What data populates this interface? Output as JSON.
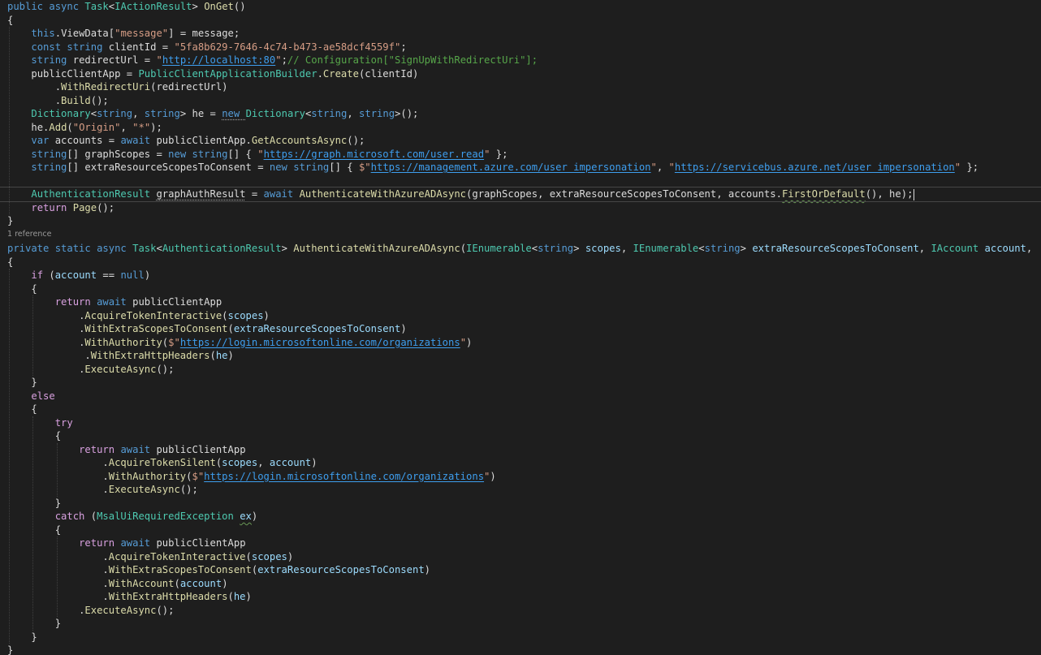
{
  "editor": {
    "colors": {
      "background": "#1e1e1e",
      "keyword": "#569cd6",
      "control": "#d8a0df",
      "type": "#4ec9b0",
      "method": "#dcdcaa",
      "string": "#d69d85",
      "comment": "#57a64a",
      "variable": "#9cdcfe",
      "plain": "#dcdcdc",
      "url": "#3e9eee"
    },
    "code_lens": "1 reference",
    "lines": [
      [
        [
          "public ",
          "keyword"
        ],
        [
          "async ",
          "keyword"
        ],
        [
          "Task",
          "type"
        ],
        [
          "<",
          "plain"
        ],
        [
          "IActionResult",
          "type"
        ],
        [
          "> ",
          "plain"
        ],
        [
          "OnGet",
          "method"
        ],
        [
          "()",
          "plain"
        ]
      ],
      [
        [
          "{",
          "plain"
        ]
      ],
      [
        [
          "    ",
          "plain"
        ],
        [
          "this",
          "keyword"
        ],
        [
          ".",
          "plain"
        ],
        [
          "ViewData",
          "plain"
        ],
        [
          "[",
          "plain"
        ],
        [
          "\"message\"",
          "string"
        ],
        [
          "] = ",
          "plain"
        ],
        [
          "message",
          "plain"
        ],
        [
          ";",
          "plain"
        ]
      ],
      [
        [
          "    ",
          "plain"
        ],
        [
          "const ",
          "keyword"
        ],
        [
          "string ",
          "keyword"
        ],
        [
          "clientId",
          "plain"
        ],
        [
          " = ",
          "plain"
        ],
        [
          "\"5fa8b629-7646-4c74-b473-ae58dcf4559f\"",
          "string"
        ],
        [
          ";",
          "plain"
        ]
      ],
      [
        [
          "    ",
          "plain"
        ],
        [
          "string ",
          "keyword"
        ],
        [
          "redirectUrl",
          "plain"
        ],
        [
          " = ",
          "plain"
        ],
        [
          "\"",
          "string"
        ],
        [
          "http://localhost:80",
          "url"
        ],
        [
          "\"",
          "string"
        ],
        [
          ";",
          "plain"
        ],
        [
          "// Configuration[\"SignUpWithRedirectUri\"];",
          "comment"
        ]
      ],
      [
        [
          "    ",
          "plain"
        ],
        [
          "publicClientApp",
          "plain"
        ],
        [
          " = ",
          "plain"
        ],
        [
          "PublicClientApplicationBuilder",
          "type"
        ],
        [
          ".",
          "plain"
        ],
        [
          "Create",
          "method"
        ],
        [
          "(",
          "plain"
        ],
        [
          "clientId",
          "plain"
        ],
        [
          ")",
          "plain"
        ]
      ],
      [
        [
          "        ",
          "plain"
        ],
        [
          ".",
          "plain"
        ],
        [
          "WithRedirectUri",
          "method"
        ],
        [
          "(",
          "plain"
        ],
        [
          "redirectUrl",
          "plain"
        ],
        [
          ")",
          "plain"
        ]
      ],
      [
        [
          "        ",
          "plain"
        ],
        [
          ".",
          "plain"
        ],
        [
          "Build",
          "method"
        ],
        [
          "();",
          "plain"
        ]
      ],
      [
        [
          "    ",
          "plain"
        ],
        [
          "Dictionary",
          "type"
        ],
        [
          "<",
          "plain"
        ],
        [
          "string",
          "keyword"
        ],
        [
          ", ",
          "plain"
        ],
        [
          "string",
          "keyword"
        ],
        [
          "> ",
          "plain"
        ],
        [
          "he",
          "plain"
        ],
        [
          " = ",
          "plain"
        ],
        [
          "new ",
          "keyword"
        ],
        [
          "Dictionary",
          "type"
        ],
        [
          "<",
          "plain"
        ],
        [
          "string",
          "keyword"
        ],
        [
          ", ",
          "plain"
        ],
        [
          "string",
          "keyword"
        ],
        [
          ">();",
          "plain"
        ]
      ],
      [
        [
          "    ",
          "plain"
        ],
        [
          "he",
          "plain"
        ],
        [
          ".",
          "plain"
        ],
        [
          "Add",
          "method"
        ],
        [
          "(",
          "plain"
        ],
        [
          "\"Origin\"",
          "string"
        ],
        [
          ", ",
          "plain"
        ],
        [
          "\"*\"",
          "string"
        ],
        [
          ");",
          "plain"
        ]
      ],
      [
        [
          "    ",
          "plain"
        ],
        [
          "var ",
          "keyword"
        ],
        [
          "accounts",
          "plain"
        ],
        [
          " = ",
          "plain"
        ],
        [
          "await ",
          "keyword"
        ],
        [
          "publicClientApp",
          "plain"
        ],
        [
          ".",
          "plain"
        ],
        [
          "GetAccountsAsync",
          "method"
        ],
        [
          "();",
          "plain"
        ]
      ],
      [
        [
          "    ",
          "plain"
        ],
        [
          "string",
          "keyword"
        ],
        [
          "[] ",
          "plain"
        ],
        [
          "graphScopes",
          "plain"
        ],
        [
          " = ",
          "plain"
        ],
        [
          "new ",
          "keyword"
        ],
        [
          "string",
          "keyword"
        ],
        [
          "[] { ",
          "plain"
        ],
        [
          "\"",
          "string"
        ],
        [
          "https://graph.microsoft.com/user.read",
          "url"
        ],
        [
          "\"",
          "string"
        ],
        [
          " };",
          "plain"
        ]
      ],
      [
        [
          "    ",
          "plain"
        ],
        [
          "string",
          "keyword"
        ],
        [
          "[] ",
          "plain"
        ],
        [
          "extraResourceScopesToConsent",
          "plain"
        ],
        [
          " = ",
          "plain"
        ],
        [
          "new ",
          "keyword"
        ],
        [
          "string",
          "keyword"
        ],
        [
          "[] { ",
          "plain"
        ],
        [
          "$\"",
          "string"
        ],
        [
          "https://management.azure.com/user_impersonation",
          "url"
        ],
        [
          "\"",
          "string"
        ],
        [
          ", ",
          "plain"
        ],
        [
          "\"",
          "string"
        ],
        [
          "https://servicebus.azure.net/user_impersonation",
          "url"
        ],
        [
          "\"",
          "string"
        ],
        [
          " };",
          "plain"
        ]
      ],
      [],
      [
        [
          "    ",
          "plain"
        ],
        [
          "AuthenticationResult ",
          "type"
        ],
        [
          "graphAuthResult",
          "plain"
        ],
        [
          " = ",
          "plain"
        ],
        [
          "await ",
          "keyword"
        ],
        [
          "AuthenticateWithAzureADAsync",
          "method"
        ],
        [
          "(",
          "plain"
        ],
        [
          "graphScopes",
          "plain"
        ],
        [
          ", ",
          "plain"
        ],
        [
          "extraResourceScopesToConsent",
          "plain"
        ],
        [
          ", ",
          "plain"
        ],
        [
          "accounts",
          "plain"
        ],
        [
          ".",
          "plain"
        ],
        [
          "FirstOrDefault",
          "method"
        ],
        [
          "(), ",
          "plain"
        ],
        [
          "he",
          "plain"
        ],
        [
          ");",
          "plain"
        ]
      ],
      [
        [
          "    ",
          "plain"
        ],
        [
          "return ",
          "control"
        ],
        [
          "Page",
          "method"
        ],
        [
          "();",
          "plain"
        ]
      ],
      [
        [
          "}",
          "plain"
        ]
      ],
      [
        [
          "private ",
          "keyword"
        ],
        [
          "static ",
          "keyword"
        ],
        [
          "async ",
          "keyword"
        ],
        [
          "Task",
          "type"
        ],
        [
          "<",
          "plain"
        ],
        [
          "AuthenticationResult",
          "type"
        ],
        [
          "> ",
          "plain"
        ],
        [
          "AuthenticateWithAzureADAsync",
          "method"
        ],
        [
          "(",
          "plain"
        ],
        [
          "IEnumerable",
          "type"
        ],
        [
          "<",
          "plain"
        ],
        [
          "string",
          "keyword"
        ],
        [
          "> ",
          "plain"
        ],
        [
          "scopes",
          "variable"
        ],
        [
          ", ",
          "plain"
        ],
        [
          "IEnumerable",
          "type"
        ],
        [
          "<",
          "plain"
        ],
        [
          "string",
          "keyword"
        ],
        [
          "> ",
          "plain"
        ],
        [
          "extraResourceScopesToConsent",
          "variable"
        ],
        [
          ", ",
          "plain"
        ],
        [
          "IAccount ",
          "type"
        ],
        [
          "account",
          "variable"
        ],
        [
          ",",
          "plain"
        ]
      ],
      [
        [
          "{",
          "plain"
        ]
      ],
      [
        [
          "    ",
          "plain"
        ],
        [
          "if ",
          "control"
        ],
        [
          "(",
          "plain"
        ],
        [
          "account",
          "variable"
        ],
        [
          " == ",
          "plain"
        ],
        [
          "null",
          "keyword"
        ],
        [
          ")",
          "plain"
        ]
      ],
      [
        [
          "    ",
          "plain"
        ],
        [
          "{",
          "plain"
        ]
      ],
      [
        [
          "        ",
          "plain"
        ],
        [
          "return ",
          "control"
        ],
        [
          "await ",
          "keyword"
        ],
        [
          "publicClientApp",
          "plain"
        ]
      ],
      [
        [
          "            ",
          "plain"
        ],
        [
          ".",
          "plain"
        ],
        [
          "AcquireTokenInteractive",
          "method"
        ],
        [
          "(",
          "plain"
        ],
        [
          "scopes",
          "variable"
        ],
        [
          ")",
          "plain"
        ]
      ],
      [
        [
          "            ",
          "plain"
        ],
        [
          ".",
          "plain"
        ],
        [
          "WithExtraScopesToConsent",
          "method"
        ],
        [
          "(",
          "plain"
        ],
        [
          "extraResourceScopesToConsent",
          "variable"
        ],
        [
          ")",
          "plain"
        ]
      ],
      [
        [
          "            ",
          "plain"
        ],
        [
          ".",
          "plain"
        ],
        [
          "WithAuthority",
          "method"
        ],
        [
          "(",
          "plain"
        ],
        [
          "$\"",
          "string"
        ],
        [
          "https://login.microsoftonline.com/organizations",
          "url"
        ],
        [
          "\"",
          "string"
        ],
        [
          ")",
          "plain"
        ]
      ],
      [
        [
          "             ",
          "plain"
        ],
        [
          ".",
          "plain"
        ],
        [
          "WithExtraHttpHeaders",
          "method"
        ],
        [
          "(",
          "plain"
        ],
        [
          "he",
          "variable"
        ],
        [
          ")",
          "plain"
        ]
      ],
      [
        [
          "            ",
          "plain"
        ],
        [
          ".",
          "plain"
        ],
        [
          "ExecuteAsync",
          "method"
        ],
        [
          "();",
          "plain"
        ]
      ],
      [
        [
          "    ",
          "plain"
        ],
        [
          "}",
          "plain"
        ]
      ],
      [
        [
          "    ",
          "plain"
        ],
        [
          "else",
          "control"
        ]
      ],
      [
        [
          "    ",
          "plain"
        ],
        [
          "{",
          "plain"
        ]
      ],
      [
        [
          "        ",
          "plain"
        ],
        [
          "try",
          "control"
        ]
      ],
      [
        [
          "        ",
          "plain"
        ],
        [
          "{",
          "plain"
        ]
      ],
      [
        [
          "            ",
          "plain"
        ],
        [
          "return ",
          "control"
        ],
        [
          "await ",
          "keyword"
        ],
        [
          "publicClientApp",
          "plain"
        ]
      ],
      [
        [
          "                ",
          "plain"
        ],
        [
          ".",
          "plain"
        ],
        [
          "AcquireTokenSilent",
          "method"
        ],
        [
          "(",
          "plain"
        ],
        [
          "scopes",
          "variable"
        ],
        [
          ", ",
          "plain"
        ],
        [
          "account",
          "variable"
        ],
        [
          ")",
          "plain"
        ]
      ],
      [
        [
          "                ",
          "plain"
        ],
        [
          ".",
          "plain"
        ],
        [
          "WithAuthority",
          "method"
        ],
        [
          "(",
          "plain"
        ],
        [
          "$\"",
          "string"
        ],
        [
          "https://login.microsoftonline.com/organizations",
          "url"
        ],
        [
          "\"",
          "string"
        ],
        [
          ")",
          "plain"
        ]
      ],
      [
        [
          "                ",
          "plain"
        ],
        [
          ".",
          "plain"
        ],
        [
          "ExecuteAsync",
          "method"
        ],
        [
          "();",
          "plain"
        ]
      ],
      [
        [
          "        ",
          "plain"
        ],
        [
          "}",
          "plain"
        ]
      ],
      [
        [
          "        ",
          "plain"
        ],
        [
          "catch ",
          "control"
        ],
        [
          "(",
          "plain"
        ],
        [
          "MsalUiRequiredException ",
          "type"
        ],
        [
          "ex",
          "variable"
        ],
        [
          ")",
          "plain"
        ]
      ],
      [
        [
          "        ",
          "plain"
        ],
        [
          "{",
          "plain"
        ]
      ],
      [
        [
          "            ",
          "plain"
        ],
        [
          "return ",
          "control"
        ],
        [
          "await ",
          "keyword"
        ],
        [
          "publicClientApp",
          "plain"
        ]
      ],
      [
        [
          "                ",
          "plain"
        ],
        [
          ".",
          "plain"
        ],
        [
          "AcquireTokenInteractive",
          "method"
        ],
        [
          "(",
          "plain"
        ],
        [
          "scopes",
          "variable"
        ],
        [
          ")",
          "plain"
        ]
      ],
      [
        [
          "                ",
          "plain"
        ],
        [
          ".",
          "plain"
        ],
        [
          "WithExtraScopesToConsent",
          "method"
        ],
        [
          "(",
          "plain"
        ],
        [
          "extraResourceScopesToConsent",
          "variable"
        ],
        [
          ")",
          "plain"
        ]
      ],
      [
        [
          "                ",
          "plain"
        ],
        [
          ".",
          "plain"
        ],
        [
          "WithAccount",
          "method"
        ],
        [
          "(",
          "plain"
        ],
        [
          "account",
          "variable"
        ],
        [
          ")",
          "plain"
        ]
      ],
      [
        [
          "                ",
          "plain"
        ],
        [
          ".",
          "plain"
        ],
        [
          "WithExtraHttpHeaders",
          "method"
        ],
        [
          "(",
          "plain"
        ],
        [
          "he",
          "variable"
        ],
        [
          ")",
          "plain"
        ]
      ],
      [
        [
          "            ",
          "plain"
        ],
        [
          ".",
          "plain"
        ],
        [
          "ExecuteAsync",
          "method"
        ],
        [
          "();",
          "plain"
        ]
      ],
      [
        [
          "        ",
          "plain"
        ],
        [
          "}",
          "plain"
        ]
      ],
      [
        [
          "    ",
          "plain"
        ],
        [
          "}",
          "plain"
        ]
      ],
      [
        [
          "}",
          "plain"
        ]
      ]
    ]
  }
}
